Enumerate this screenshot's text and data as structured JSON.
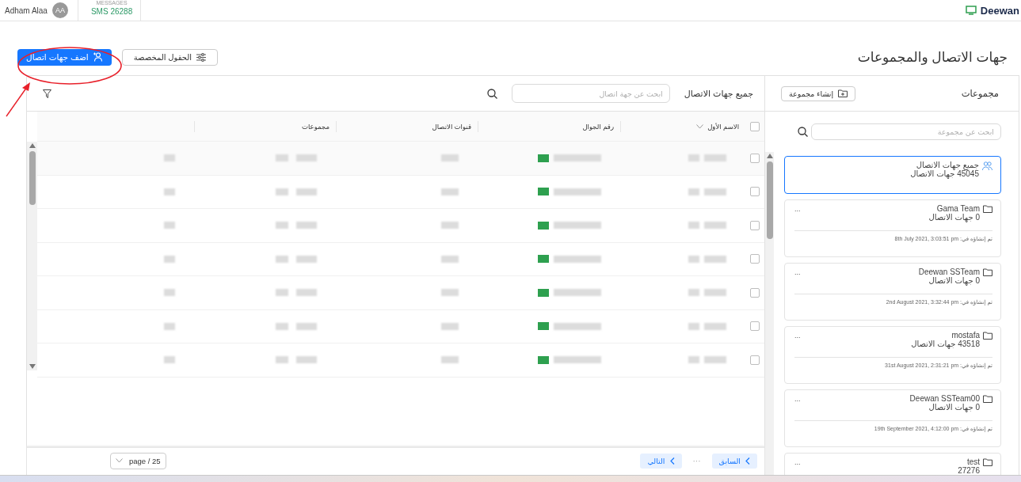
{
  "top_bar": {
    "user_name": "Adham Alaa",
    "avatar_initials": "AA",
    "messages_label": "MESSAGES",
    "sms_balance": "SMS 26288",
    "brand": "Deewan"
  },
  "page_title": "جهات الاتصال والمجموعات",
  "toolbar": {
    "add_contacts_button": "اضف جهات اتصال",
    "custom_fields_button": "الحقول المخصصة"
  },
  "contacts": {
    "title": "جميع جهات الاتصال",
    "search": {
      "placeholder": "ابحث عن جهة اتصال"
    },
    "select_all": {
      "checked": false
    },
    "columns": [
      "الاسم الأول",
      "رقم الجوال",
      "قنوات الاتصال",
      "مجموعات"
    ],
    "rows": [
      {
        "checked": false
      },
      {
        "checked": false
      },
      {
        "checked": false
      },
      {
        "checked": false
      },
      {
        "checked": false
      },
      {
        "checked": false
      },
      {
        "checked": false
      }
    ],
    "pagination": {
      "previous": "السابق",
      "ellipsis": "···",
      "next": "التالي",
      "page_size": "page / 25"
    }
  },
  "groups": {
    "title": "مجموعات",
    "create_button": "إنشاء مجموعة",
    "search": {
      "placeholder": "ابحث عن مجموعة"
    },
    "items": [
      {
        "kind": "all",
        "name": "جميع جهات الاتصال",
        "contacts": "45045 جهات الاتصال",
        "selected": true
      },
      {
        "kind": "group",
        "name": "Gama Team",
        "contacts": "0 جهات الاتصال",
        "menu": "...",
        "created": "تم إنشاؤه في: 8th July 2021, 3:03:51 pm",
        "selected": false
      },
      {
        "kind": "group",
        "name": "Deewan SSTeam",
        "contacts": "0 جهات الاتصال",
        "menu": "...",
        "created": "تم إنشاؤه في: 2nd August 2021, 3:32:44 pm",
        "selected": false
      },
      {
        "kind": "group",
        "name": "mostafa",
        "contacts": "43518 جهات الاتصال",
        "menu": "...",
        "created": "تم إنشاؤه في: 31st August 2021, 2:31:21 pm",
        "selected": false
      },
      {
        "kind": "group",
        "name": "Deewan SSTeam00",
        "contacts": "0 جهات الاتصال",
        "menu": "...",
        "created": "تم إنشاؤه في: 19th September 2021, 4:12:00 pm",
        "selected": false
      },
      {
        "kind": "group",
        "name": "test",
        "contacts": "27276",
        "menu": "...",
        "selected": false
      }
    ]
  }
}
